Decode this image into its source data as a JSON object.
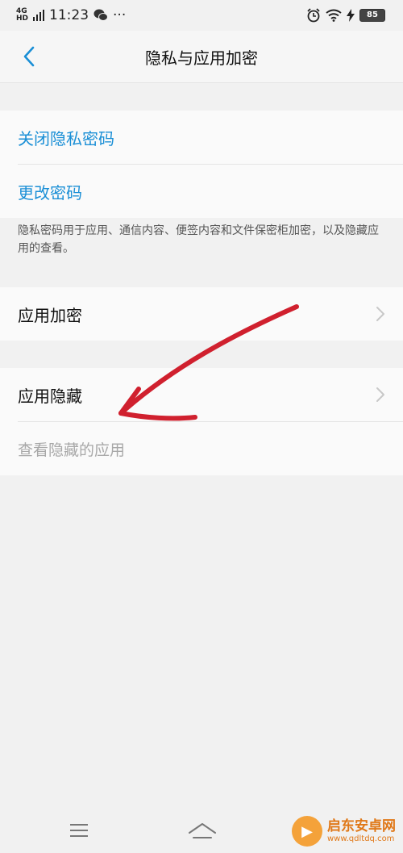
{
  "status_bar": {
    "network": "4G",
    "network_sub": "HD",
    "time": "11:23",
    "more": "···",
    "battery": "85"
  },
  "header": {
    "title": "隐私与应用加密"
  },
  "password_section": {
    "close_password": "关闭隐私密码",
    "change_password": "更改密码"
  },
  "description": "隐私密码用于应用、通信内容、便签内容和文件保密柜加密，以及隐藏应用的查看。",
  "app_encrypt_section": {
    "app_encrypt": "应用加密"
  },
  "app_hide_section": {
    "app_hide": "应用隐藏",
    "view_hidden": "查看隐藏的应用"
  },
  "watermark": {
    "name": "启东安卓网",
    "url": "www.qdltdq.com"
  },
  "colors": {
    "link": "#1a8fd6",
    "annotation": "#d0202e"
  }
}
